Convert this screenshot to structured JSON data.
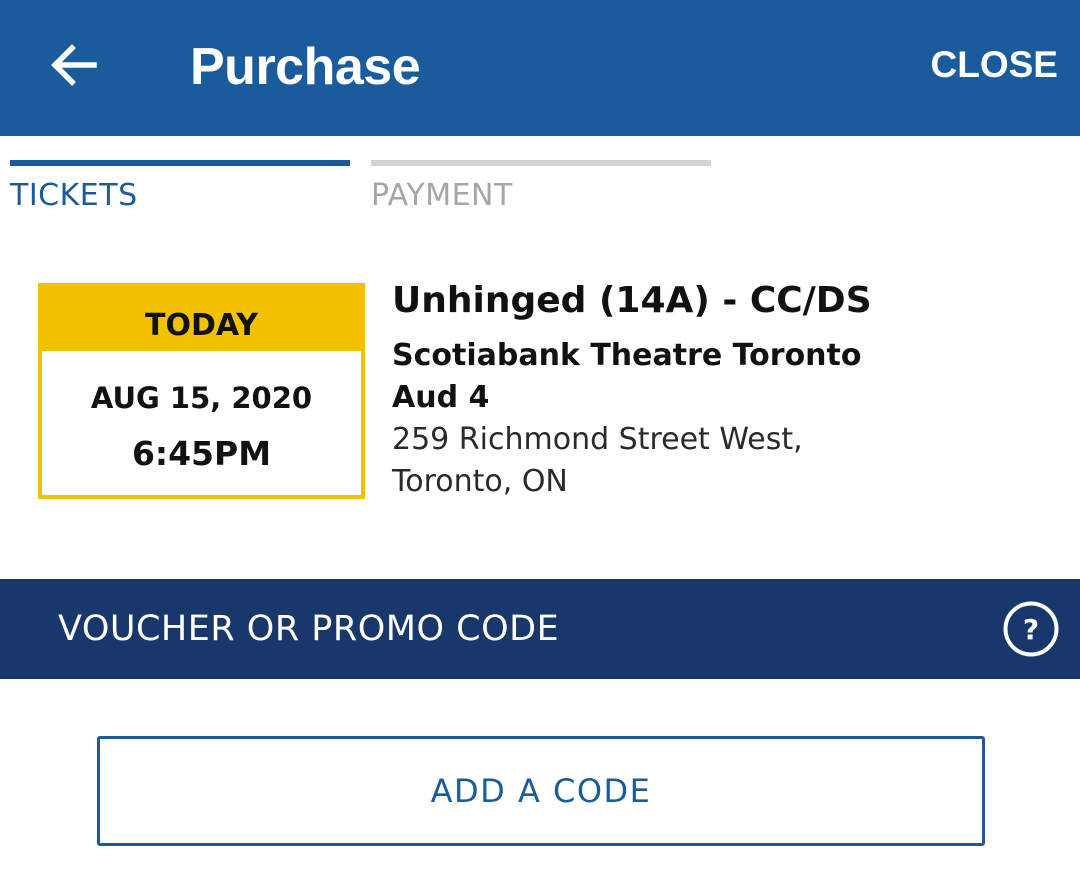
{
  "header": {
    "title": "Purchase",
    "close_label": "CLOSE",
    "back_icon": "arrow-left-icon"
  },
  "tabs": [
    {
      "label": "TICKETS",
      "active": true
    },
    {
      "label": "PAYMENT",
      "active": false
    }
  ],
  "showtime": {
    "day_label": "TODAY",
    "date": "AUG 15, 2020",
    "time": "6:45PM"
  },
  "movie": {
    "title": "Unhinged (14A) - CC/DS",
    "theatre": "Scotiabank Theatre Toronto",
    "auditorium": "Aud 4",
    "address_line1": "259 Richmond Street West,",
    "address_line2": "Toronto, ON"
  },
  "promo": {
    "title": "VOUCHER OR PROMO CODE",
    "help_icon": "question-circle-icon",
    "add_button_label": "ADD A CODE"
  },
  "colors": {
    "primary": "#1a5b9c",
    "promo_header": "#18386b",
    "accent_yellow": "#f2c200",
    "inactive_tab": "#a6a6a6"
  }
}
